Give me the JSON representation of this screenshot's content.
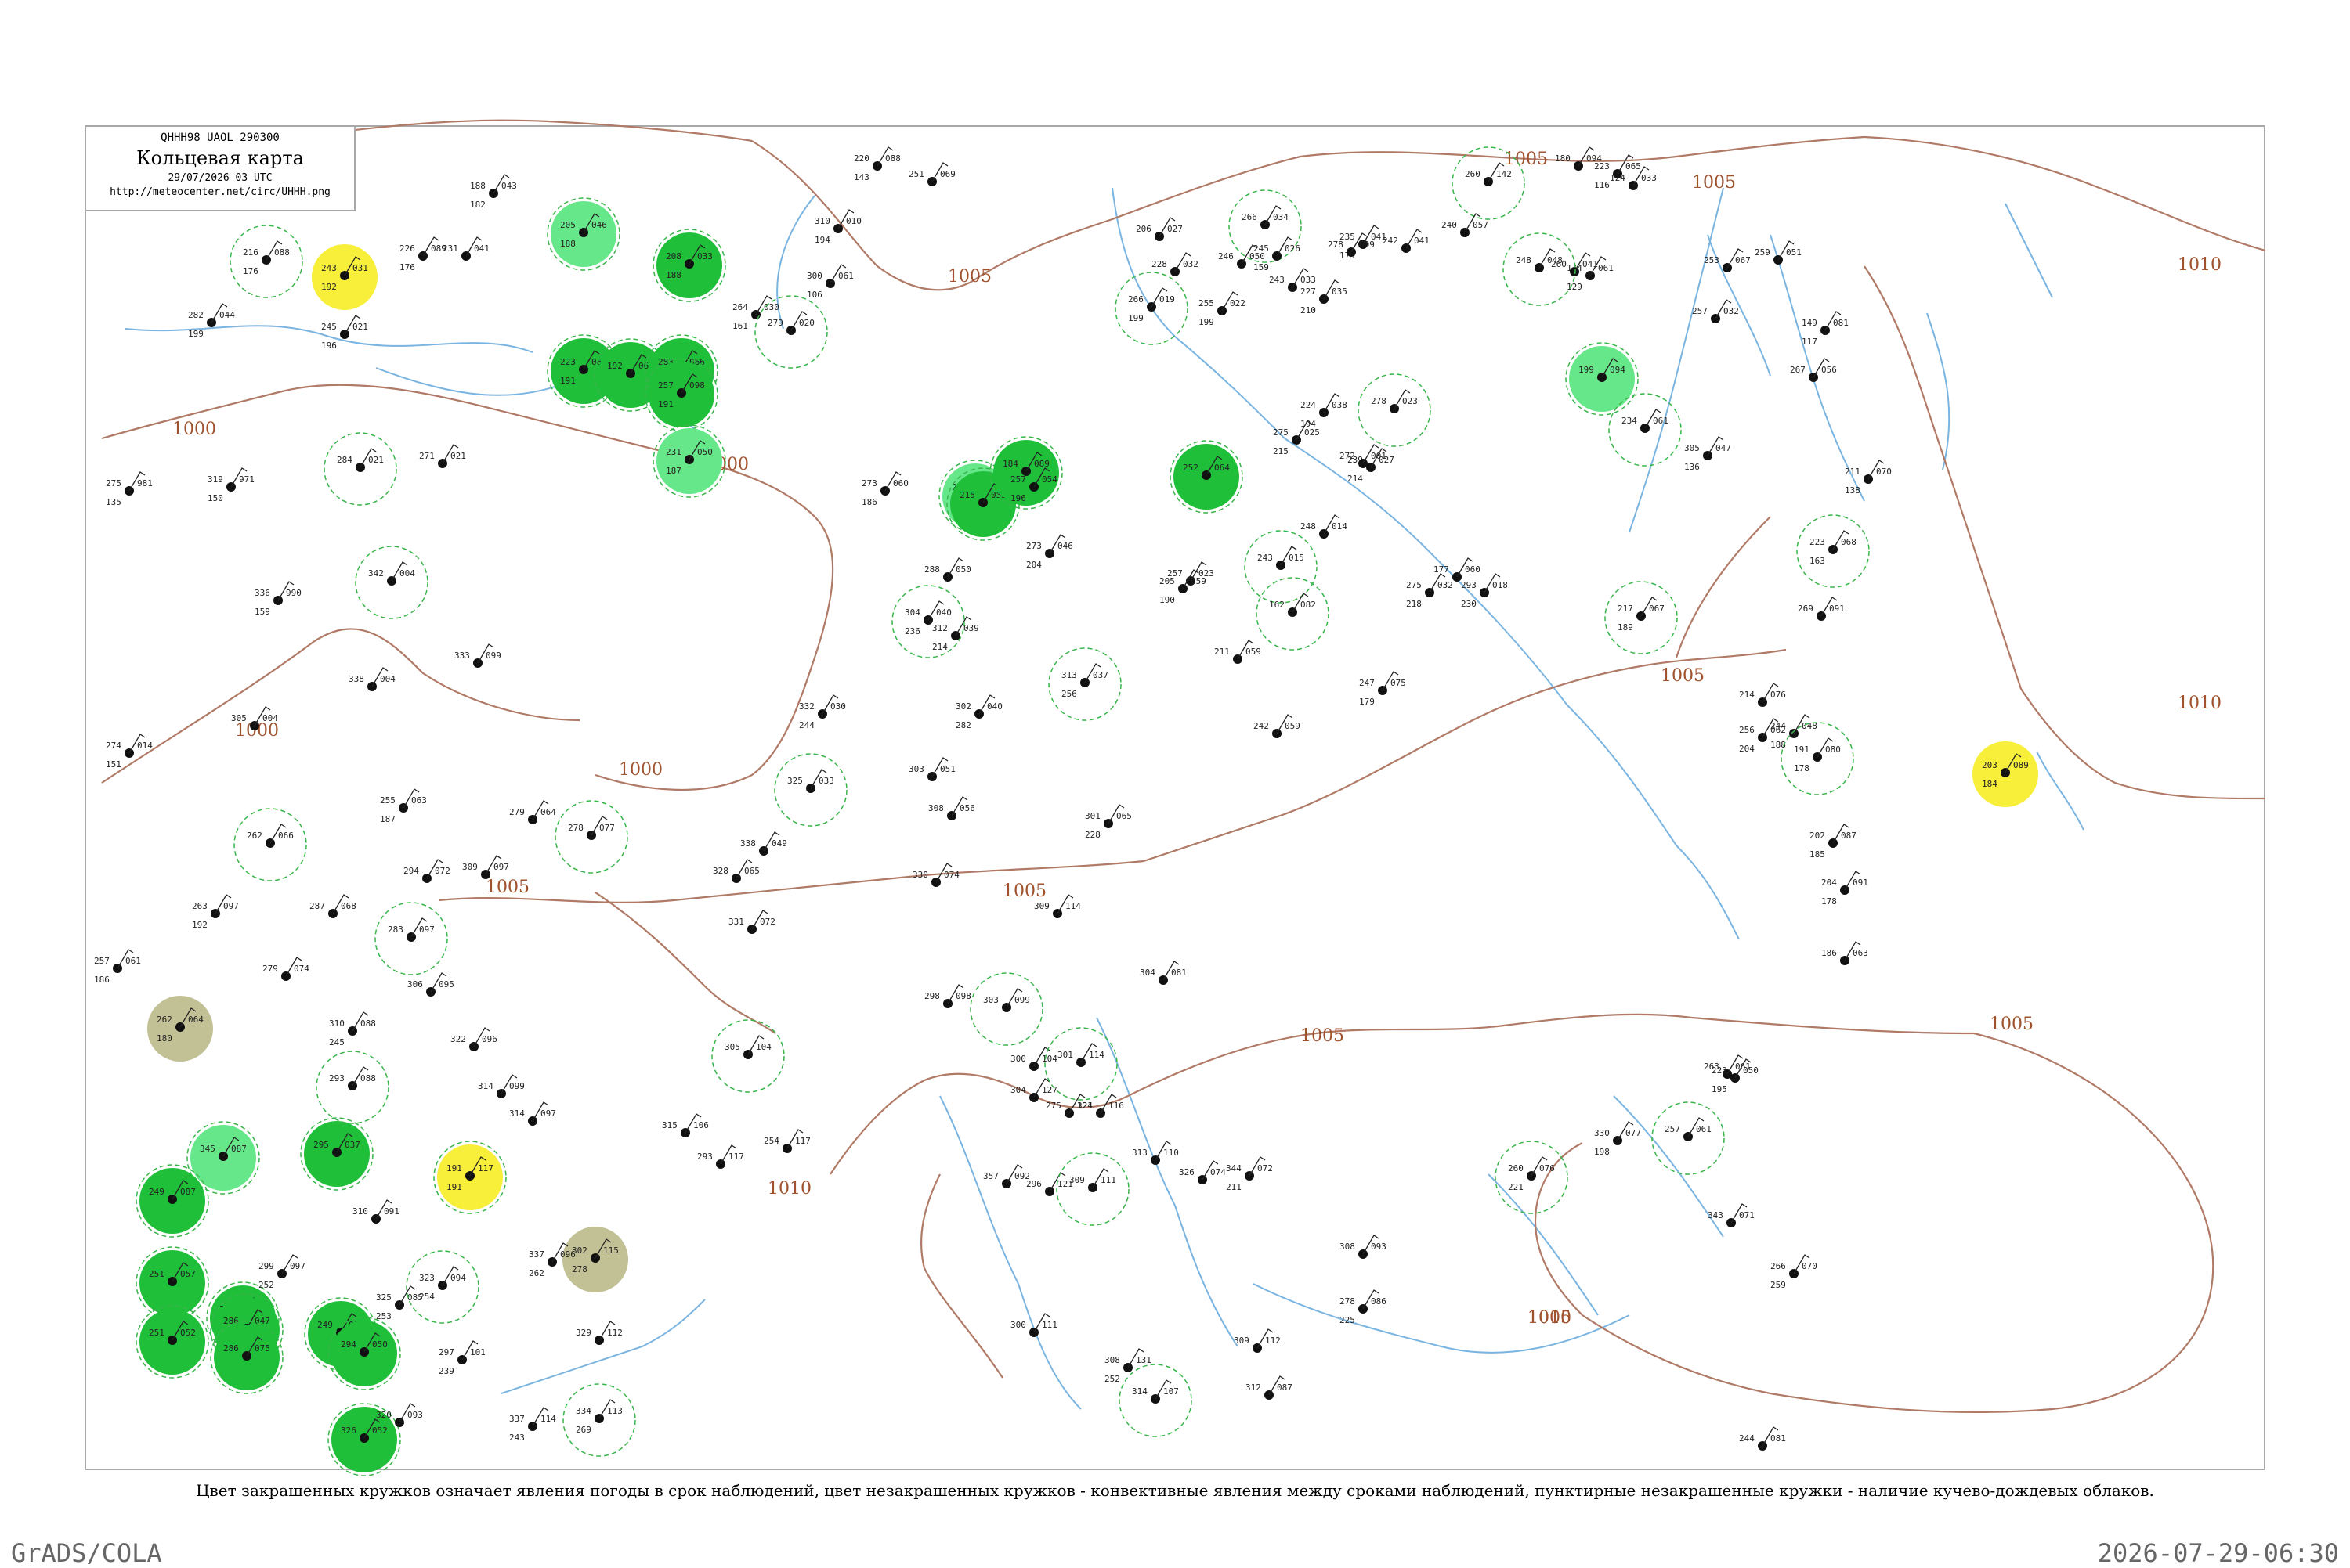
{
  "header": {
    "code": "QHHH98 UAOL 290300",
    "title": "Кольцевая карта",
    "date": "29/07/2026 03 UTC",
    "url": "http://meteocenter.net/circ/UHHH.png"
  },
  "caption": "Цвет закрашенных кружков означает явления погоды в срок наблюдений, цвет незакрашенных кружков - конвективные явления между сроками наблюдений, пунктирные незакрашенные кружки - наличие кучево-дождевых облаков.",
  "footer": {
    "left": "GrADS/COLA",
    "right": "2026-07-29-06:30"
  },
  "colors": {
    "isobar": "#b07a66",
    "water": "#7ab4e0",
    "rain": "#1fbf3a",
    "shower": "#66e88a",
    "thunder": "#f7ef3a",
    "haze": "#c2c095",
    "cb": "#39b54a",
    "frame": "#a8a8a8"
  },
  "isobar_labels": [
    "1005",
    "1005",
    "1005",
    "1005",
    "1005",
    "1005",
    "1005",
    "1005",
    "1005",
    "1010",
    "1010",
    "1010",
    "1010",
    "1000",
    "1000",
    "1000",
    "1000"
  ],
  "stations": [
    {
      "t": "243",
      "p": "031",
      "d": "192",
      "kind": "thunder"
    },
    {
      "t": "205",
      "p": "046",
      "d": "188",
      "kind": "shower"
    },
    {
      "t": "223",
      "p": "063",
      "d": "191",
      "kind": "rain"
    },
    {
      "t": "192",
      "p": "063",
      "d": "",
      "kind": "rain"
    },
    {
      "t": "208",
      "p": "033",
      "d": "188",
      "kind": "rain"
    },
    {
      "t": "283",
      "p": "066",
      "d": "196",
      "kind": "rain"
    },
    {
      "t": "257",
      "p": "098",
      "d": "191",
      "kind": "rain"
    },
    {
      "t": "231",
      "p": "050",
      "d": "187",
      "kind": "shower"
    },
    {
      "t": "283",
      "p": "052",
      "d": "",
      "kind": "shower"
    },
    {
      "t": "215",
      "p": "053",
      "d": "",
      "kind": "rain"
    },
    {
      "t": "184",
      "p": "089",
      "d": "",
      "kind": "rain"
    },
    {
      "t": "252",
      "p": "064",
      "d": "",
      "kind": "rain"
    },
    {
      "t": "203",
      "p": "089",
      "d": "184",
      "kind": "thunder"
    },
    {
      "t": "199",
      "p": "094",
      "d": "",
      "kind": "shower"
    },
    {
      "t": "262",
      "p": "064",
      "d": "180",
      "kind": "haze"
    },
    {
      "t": "345",
      "p": "087",
      "d": "",
      "kind": "shower"
    },
    {
      "t": "191",
      "p": "117",
      "d": "191",
      "kind": "thunder"
    },
    {
      "t": "302",
      "p": "115",
      "d": "278",
      "kind": "haze"
    },
    {
      "t": "249",
      "p": "087",
      "d": "",
      "kind": "rain"
    },
    {
      "t": "251",
      "p": "057",
      "d": "",
      "kind": "rain"
    },
    {
      "t": "251",
      "p": "052",
      "d": "",
      "kind": "rain"
    },
    {
      "t": "274",
      "p": "056",
      "d": "",
      "kind": "rain"
    },
    {
      "t": "295",
      "p": "037",
      "d": "",
      "kind": "rain"
    },
    {
      "t": "286",
      "p": "047",
      "d": "",
      "kind": "rain"
    },
    {
      "t": "286",
      "p": "075",
      "d": "",
      "kind": "rain"
    },
    {
      "t": "249",
      "p": "082",
      "d": "",
      "kind": "rain"
    },
    {
      "t": "326",
      "p": "052",
      "d": "",
      "kind": "rain"
    },
    {
      "t": "294",
      "p": "050",
      "d": "",
      "kind": "rain"
    },
    {
      "t": "220",
      "p": "088",
      "d": "143",
      "kind": "plain"
    },
    {
      "t": "251",
      "p": "069",
      "d": "",
      "kind": "plain"
    },
    {
      "t": "188",
      "p": "043",
      "d": "182",
      "kind": "plain"
    },
    {
      "t": "216",
      "p": "088",
      "d": "176",
      "kind": "plain"
    },
    {
      "t": "226",
      "p": "089",
      "d": "176",
      "kind": "plain"
    },
    {
      "t": "231",
      "p": "041",
      "d": "",
      "kind": "plain"
    },
    {
      "t": "245",
      "p": "021",
      "d": "196",
      "kind": "plain"
    },
    {
      "t": "282",
      "p": "044",
      "d": "199",
      "kind": "plain"
    },
    {
      "t": "284",
      "p": "021",
      "d": "",
      "kind": "plain"
    },
    {
      "t": "271",
      "p": "021",
      "d": "",
      "kind": "plain"
    },
    {
      "t": "275",
      "p": "981",
      "d": "135",
      "kind": "plain"
    },
    {
      "t": "319",
      "p": "971",
      "d": "150",
      "kind": "plain"
    },
    {
      "t": "336",
      "p": "990",
      "d": "159",
      "kind": "plain"
    },
    {
      "t": "342",
      "p": "004",
      "d": "",
      "kind": "plain"
    },
    {
      "t": "333",
      "p": "099",
      "d": "",
      "kind": "plain"
    },
    {
      "t": "338",
      "p": "004",
      "d": "",
      "kind": "plain"
    },
    {
      "t": "305",
      "p": "004",
      "d": "",
      "kind": "plain"
    },
    {
      "t": "274",
      "p": "014",
      "d": "151",
      "kind": "plain"
    },
    {
      "t": "262",
      "p": "066",
      "d": "",
      "kind": "plain"
    },
    {
      "t": "263",
      "p": "097",
      "d": "192",
      "kind": "plain"
    },
    {
      "t": "257",
      "p": "061",
      "d": "186",
      "kind": "plain"
    },
    {
      "t": "279",
      "p": "074",
      "d": "",
      "kind": "plain"
    },
    {
      "t": "287",
      "p": "068",
      "d": "",
      "kind": "plain"
    },
    {
      "t": "283",
      "p": "097",
      "d": "",
      "kind": "plain"
    },
    {
      "t": "255",
      "p": "063",
      "d": "187",
      "kind": "plain"
    },
    {
      "t": "294",
      "p": "072",
      "d": "",
      "kind": "plain"
    },
    {
      "t": "309",
      "p": "097",
      "d": "",
      "kind": "plain"
    },
    {
      "t": "279",
      "p": "064",
      "d": "",
      "kind": "plain"
    },
    {
      "t": "278",
      "p": "077",
      "d": "",
      "kind": "plain"
    },
    {
      "t": "310",
      "p": "088",
      "d": "245",
      "kind": "plain"
    },
    {
      "t": "306",
      "p": "095",
      "d": "",
      "kind": "plain"
    },
    {
      "t": "322",
      "p": "096",
      "d": "",
      "kind": "plain"
    },
    {
      "t": "314",
      "p": "099",
      "d": "",
      "kind": "plain"
    },
    {
      "t": "293",
      "p": "088",
      "d": "",
      "kind": "plain"
    },
    {
      "t": "314",
      "p": "097",
      "d": "",
      "kind": "plain"
    },
    {
      "t": "310",
      "p": "091",
      "d": "",
      "kind": "plain"
    },
    {
      "t": "299",
      "p": "097",
      "d": "252",
      "kind": "plain"
    },
    {
      "t": "325",
      "p": "085",
      "d": "253",
      "kind": "plain"
    },
    {
      "t": "323",
      "p": "094",
      "d": "254",
      "kind": "plain"
    },
    {
      "t": "297",
      "p": "101",
      "d": "239",
      "kind": "plain"
    },
    {
      "t": "320",
      "p": "093",
      "d": "",
      "kind": "plain"
    },
    {
      "t": "337",
      "p": "114",
      "d": "243",
      "kind": "plain"
    },
    {
      "t": "329",
      "p": "112",
      "d": "",
      "kind": "plain"
    },
    {
      "t": "334",
      "p": "113",
      "d": "269",
      "kind": "plain"
    },
    {
      "t": "337",
      "p": "096",
      "d": "262",
      "kind": "plain"
    },
    {
      "t": "315",
      "p": "106",
      "d": "",
      "kind": "plain"
    },
    {
      "t": "293",
      "p": "117",
      "d": "",
      "kind": "plain"
    },
    {
      "t": "254",
      "p": "117",
      "d": "",
      "kind": "plain"
    },
    {
      "t": "305",
      "p": "104",
      "d": "",
      "kind": "plain"
    },
    {
      "t": "331",
      "p": "072",
      "d": "",
      "kind": "plain"
    },
    {
      "t": "338",
      "p": "049",
      "d": "",
      "kind": "plain"
    },
    {
      "t": "328",
      "p": "065",
      "d": "",
      "kind": "plain"
    },
    {
      "t": "332",
      "p": "030",
      "d": "244",
      "kind": "plain"
    },
    {
      "t": "325",
      "p": "033",
      "d": "",
      "kind": "plain"
    },
    {
      "t": "303",
      "p": "051",
      "d": "",
      "kind": "plain"
    },
    {
      "t": "308",
      "p": "056",
      "d": "",
      "kind": "plain"
    },
    {
      "t": "330",
      "p": "074",
      "d": "",
      "kind": "plain"
    },
    {
      "t": "312",
      "p": "039",
      "d": "214",
      "kind": "plain"
    },
    {
      "t": "304",
      "p": "040",
      "d": "236",
      "kind": "plain"
    },
    {
      "t": "288",
      "p": "050",
      "d": "",
      "kind": "plain"
    },
    {
      "t": "273",
      "p": "060",
      "d": "186",
      "kind": "plain"
    },
    {
      "t": "257",
      "p": "054",
      "d": "196",
      "kind": "plain"
    },
    {
      "t": "273",
      "p": "046",
      "d": "204",
      "kind": "plain"
    },
    {
      "t": "313",
      "p": "037",
      "d": "256",
      "kind": "plain"
    },
    {
      "t": "302",
      "p": "040",
      "d": "282",
      "kind": "plain"
    },
    {
      "t": "301",
      "p": "065",
      "d": "228",
      "kind": "plain"
    },
    {
      "t": "309",
      "p": "114",
      "d": "",
      "kind": "plain"
    },
    {
      "t": "298",
      "p": "098",
      "d": "",
      "kind": "plain"
    },
    {
      "t": "303",
      "p": "099",
      "d": "",
      "kind": "plain"
    },
    {
      "t": "300",
      "p": "104",
      "d": "",
      "kind": "plain"
    },
    {
      "t": "304",
      "p": "127",
      "d": "",
      "kind": "plain"
    },
    {
      "t": "275",
      "p": "121",
      "d": "",
      "kind": "plain"
    },
    {
      "t": "296",
      "p": "121",
      "d": "",
      "kind": "plain"
    },
    {
      "t": "309",
      "p": "111",
      "d": "",
      "kind": "plain"
    },
    {
      "t": "313",
      "p": "110",
      "d": "",
      "kind": "plain"
    },
    {
      "t": "326",
      "p": "074",
      "d": "",
      "kind": "plain"
    },
    {
      "t": "344",
      "p": "072",
      "d": "211",
      "kind": "plain"
    },
    {
      "t": "304",
      "p": "081",
      "d": "",
      "kind": "plain"
    },
    {
      "t": "301",
      "p": "114",
      "d": "",
      "kind": "plain"
    },
    {
      "t": "357",
      "p": "092",
      "d": "",
      "kind": "plain"
    },
    {
      "t": "324",
      "p": "116",
      "d": "",
      "kind": "plain"
    },
    {
      "t": "300",
      "p": "111",
      "d": "",
      "kind": "plain"
    },
    {
      "t": "308",
      "p": "131",
      "d": "252",
      "kind": "plain"
    },
    {
      "t": "314",
      "p": "107",
      "d": "",
      "kind": "plain"
    },
    {
      "t": "309",
      "p": "112",
      "d": "",
      "kind": "plain"
    },
    {
      "t": "312",
      "p": "087",
      "d": "",
      "kind": "plain"
    },
    {
      "t": "308",
      "p": "093",
      "d": "",
      "kind": "plain"
    },
    {
      "t": "278",
      "p": "086",
      "d": "225",
      "kind": "plain"
    },
    {
      "t": "260",
      "p": "076",
      "d": "221",
      "kind": "plain"
    },
    {
      "t": "330",
      "p": "077",
      "d": "198",
      "kind": "plain"
    },
    {
      "t": "343",
      "p": "071",
      "d": "",
      "kind": "plain"
    },
    {
      "t": "266",
      "p": "070",
      "d": "259",
      "kind": "plain"
    },
    {
      "t": "244",
      "p": "081",
      "d": "",
      "kind": "plain"
    },
    {
      "t": "257",
      "p": "061",
      "d": "",
      "kind": "plain"
    },
    {
      "t": "263",
      "p": "061",
      "d": "",
      "kind": "plain"
    },
    {
      "t": "223",
      "p": "050",
      "d": "195",
      "kind": "plain"
    },
    {
      "t": "214",
      "p": "076",
      "d": "",
      "kind": "plain"
    },
    {
      "t": "244",
      "p": "048",
      "d": "188",
      "kind": "plain"
    },
    {
      "t": "191",
      "p": "080",
      "d": "178",
      "kind": "plain"
    },
    {
      "t": "202",
      "p": "087",
      "d": "185",
      "kind": "plain"
    },
    {
      "t": "204",
      "p": "091",
      "d": "178",
      "kind": "plain"
    },
    {
      "t": "186",
      "p": "063",
      "d": "",
      "kind": "plain"
    },
    {
      "t": "211",
      "p": "070",
      "d": "138",
      "kind": "plain"
    },
    {
      "t": "223",
      "p": "068",
      "d": "163",
      "kind": "plain"
    },
    {
      "t": "269",
      "p": "091",
      "d": "",
      "kind": "plain"
    },
    {
      "t": "259",
      "p": "051",
      "d": "",
      "kind": "plain"
    },
    {
      "t": "253",
      "p": "067",
      "d": "",
      "kind": "plain"
    },
    {
      "t": "257",
      "p": "032",
      "d": "",
      "kind": "plain"
    },
    {
      "t": "234",
      "p": "061",
      "d": "",
      "kind": "plain"
    },
    {
      "t": "305",
      "p": "047",
      "d": "136",
      "kind": "plain"
    },
    {
      "t": "174",
      "p": "061",
      "d": "129",
      "kind": "plain"
    },
    {
      "t": "124",
      "p": "033",
      "d": "",
      "kind": "plain"
    },
    {
      "t": "180",
      "p": "094",
      "d": "",
      "kind": "plain"
    },
    {
      "t": "260",
      "p": "142",
      "d": "",
      "kind": "plain"
    },
    {
      "t": "223",
      "p": "065",
      "d": "116",
      "kind": "plain"
    },
    {
      "t": "149",
      "p": "081",
      "d": "117",
      "kind": "plain"
    },
    {
      "t": "267",
      "p": "056",
      "d": "",
      "kind": "plain"
    },
    {
      "t": "260",
      "p": "041",
      "d": "",
      "kind": "plain"
    },
    {
      "t": "248",
      "p": "048",
      "d": "",
      "kind": "plain"
    },
    {
      "t": "240",
      "p": "057",
      "d": "",
      "kind": "plain"
    },
    {
      "t": "242",
      "p": "041",
      "d": "",
      "kind": "plain"
    },
    {
      "t": "235",
      "p": "041",
      "d": "175",
      "kind": "plain"
    },
    {
      "t": "227",
      "p": "035",
      "d": "210",
      "kind": "plain"
    },
    {
      "t": "266",
      "p": "034",
      "d": "",
      "kind": "plain"
    },
    {
      "t": "245",
      "p": "026",
      "d": "159",
      "kind": "plain"
    },
    {
      "t": "246",
      "p": "050",
      "d": "",
      "kind": "plain"
    },
    {
      "t": "206",
      "p": "027",
      "d": "",
      "kind": "plain"
    },
    {
      "t": "228",
      "p": "032",
      "d": "",
      "kind": "plain"
    },
    {
      "t": "266",
      "p": "019",
      "d": "199",
      "kind": "plain"
    },
    {
      "t": "278",
      "p": "009",
      "d": "",
      "kind": "plain"
    },
    {
      "t": "243",
      "p": "033",
      "d": "",
      "kind": "plain"
    },
    {
      "t": "255",
      "p": "022",
      "d": "199",
      "kind": "plain"
    },
    {
      "t": "224",
      "p": "038",
      "d": "194",
      "kind": "plain"
    },
    {
      "t": "278",
      "p": "023",
      "d": "",
      "kind": "plain"
    },
    {
      "t": "239",
      "p": "027",
      "d": "214",
      "kind": "plain"
    },
    {
      "t": "275",
      "p": "025",
      "d": "215",
      "kind": "plain"
    },
    {
      "t": "248",
      "p": "014",
      "d": "",
      "kind": "plain"
    },
    {
      "t": "272",
      "p": "001",
      "d": "",
      "kind": "plain"
    },
    {
      "t": "243",
      "p": "015",
      "d": "",
      "kind": "plain"
    },
    {
      "t": "257",
      "p": "023",
      "d": "",
      "kind": "plain"
    },
    {
      "t": "293",
      "p": "018",
      "d": "230",
      "kind": "plain"
    },
    {
      "t": "275",
      "p": "032",
      "d": "218",
      "kind": "plain"
    },
    {
      "t": "177",
      "p": "060",
      "d": "",
      "kind": "plain"
    },
    {
      "t": "162",
      "p": "082",
      "d": "",
      "kind": "plain"
    },
    {
      "t": "247",
      "p": "075",
      "d": "179",
      "kind": "plain"
    },
    {
      "t": "242",
      "p": "059",
      "d": "",
      "kind": "plain"
    },
    {
      "t": "205",
      "p": "059",
      "d": "190",
      "kind": "plain"
    },
    {
      "t": "211",
      "p": "059",
      "d": "",
      "kind": "plain"
    },
    {
      "t": "217",
      "p": "067",
      "d": "189",
      "kind": "plain"
    },
    {
      "t": "256",
      "p": "062",
      "d": "204",
      "kind": "plain"
    },
    {
      "t": "310",
      "p": "010",
      "d": "194",
      "kind": "plain"
    },
    {
      "t": "300",
      "p": "061",
      "d": "106",
      "kind": "plain"
    },
    {
      "t": "264",
      "p": "030",
      "d": "161",
      "kind": "plain"
    },
    {
      "t": "279",
      "p": "020",
      "d": "",
      "kind": "plain"
    }
  ]
}
